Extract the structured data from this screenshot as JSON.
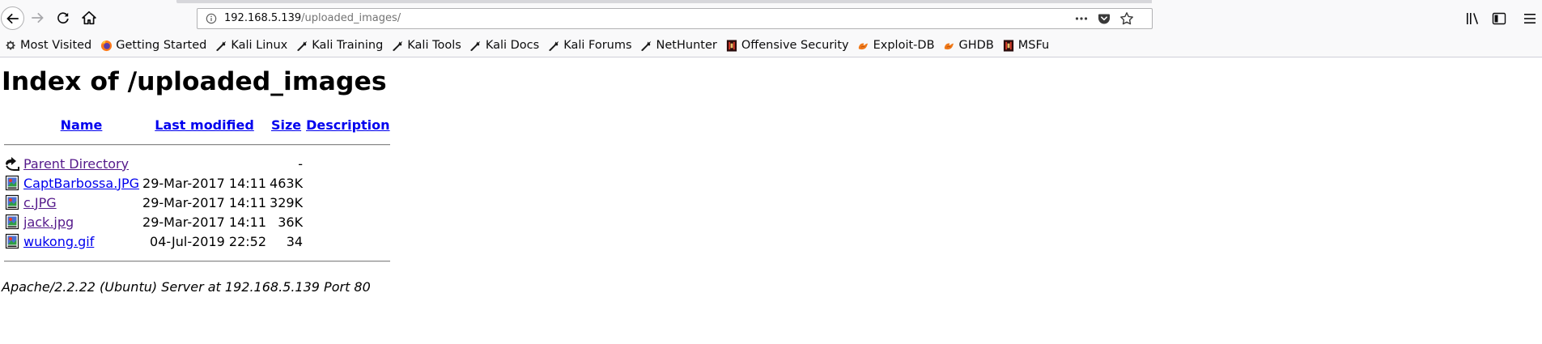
{
  "browser": {
    "url_host": "192.168.5.139",
    "url_path": "/uploaded_images/",
    "bookmarks": [
      {
        "label": "Most Visited",
        "icon": "gear-icon"
      },
      {
        "label": "Getting Started",
        "icon": "firefox-icon"
      },
      {
        "label": "Kali Linux",
        "icon": "kali-dragon-icon"
      },
      {
        "label": "Kali Training",
        "icon": "kali-dragon-icon"
      },
      {
        "label": "Kali Tools",
        "icon": "kali-dragon-icon"
      },
      {
        "label": "Kali Docs",
        "icon": "kali-dragon-icon"
      },
      {
        "label": "Kali Forums",
        "icon": "kali-dragon-icon"
      },
      {
        "label": "NetHunter",
        "icon": "kali-dragon-icon"
      },
      {
        "label": "Offensive Security",
        "icon": "offsec-icon"
      },
      {
        "label": "Exploit-DB",
        "icon": "exploit-db-icon"
      },
      {
        "label": "GHDB",
        "icon": "exploit-db-icon"
      },
      {
        "label": "MSFu",
        "icon": "offsec-icon"
      }
    ]
  },
  "page": {
    "title": "Index of /uploaded_images",
    "columns": {
      "name": "Name",
      "modified": "Last modified",
      "size": "Size",
      "description": "Description"
    },
    "parent": {
      "label": "Parent Directory",
      "size": "-"
    },
    "files": [
      {
        "name": "CaptBarbossa.JPG",
        "modified": "29-Mar-2017 14:11",
        "size": "463K"
      },
      {
        "name": "c.JPG",
        "modified": "29-Mar-2017 14:11",
        "size": "329K"
      },
      {
        "name": "jack.jpg",
        "modified": "29-Mar-2017 14:11",
        "size": "36K"
      },
      {
        "name": "wukong.gif",
        "modified": "04-Jul-2019 22:52",
        "size": "34"
      }
    ],
    "footer": "Apache/2.2.22 (Ubuntu) Server at 192.168.5.139 Port 80"
  }
}
